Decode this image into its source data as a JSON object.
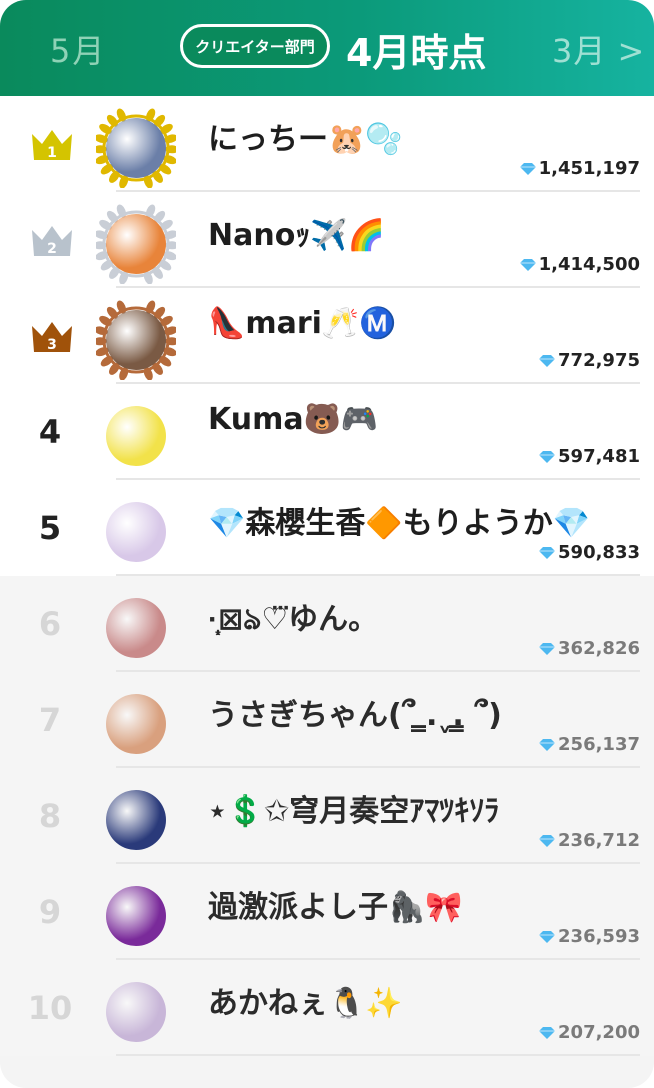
{
  "header": {
    "prev_month": "5月",
    "category": "クリエイター部門",
    "current_month": "4月時点",
    "next_month": "3月 >"
  },
  "colors": {
    "header_start": "#0a8a5c",
    "header_end": "#16b3a0",
    "gold": "#d4c400",
    "silver": "#b8c2cc",
    "bronze": "#a0520a",
    "gem": "#4db8f0"
  },
  "ranking": [
    {
      "rank": "1",
      "name": "にっちー🐹🫧",
      "score": "1,451,197",
      "medal": "gold",
      "avatar": "#6b7fa8"
    },
    {
      "rank": "2",
      "name": "Nanoｯ✈️🌈",
      "score": "1,414,500",
      "medal": "silver",
      "avatar": "#e8843a"
    },
    {
      "rank": "3",
      "name": "👠mari🥂Ⓜ️",
      "score": "772,975",
      "medal": "bronze",
      "avatar": "#7a5a44"
    },
    {
      "rank": "4",
      "name": "Kuma🐻🎮",
      "score": "597,481",
      "medal": "",
      "avatar": "#f2e24a"
    },
    {
      "rank": "5",
      "name": "💎森櫻生香🔶もりようか💎",
      "score": "590,833",
      "medal": "",
      "avatar": "#d8c8e8"
    },
    {
      "rank": "6",
      "name": "·̩͙⊠ঌ♡⃛ゆん。",
      "score": "362,826",
      "medal": "",
      "avatar": "#c98a8a"
    },
    {
      "rank": "7",
      "name": "うさぎちゃん(՞ ̳.ˬ.̳ ՞)",
      "score": "256,137",
      "medal": "",
      "avatar": "#d9a07e"
    },
    {
      "rank": "8",
      "name": "⋆💲✩穹月奏空ｱﾏﾂｷｿﾗ",
      "score": "236,712",
      "medal": "",
      "avatar": "#2a3a7a"
    },
    {
      "rank": "9",
      "name": "過激派よし子🦍🎀",
      "score": "236,593",
      "medal": "",
      "avatar": "#7a2a9a"
    },
    {
      "rank": "10",
      "name": "あかねぇ🐧✨",
      "score": "207,200",
      "medal": "",
      "avatar": "#c8b6d8"
    }
  ]
}
